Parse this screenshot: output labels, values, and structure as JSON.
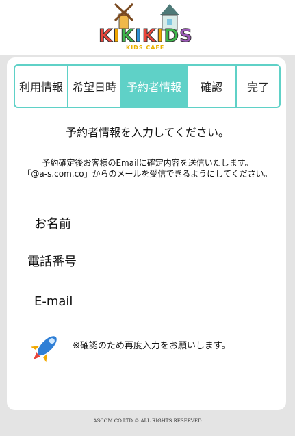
{
  "brand": {
    "logo_letters": [
      "K",
      "I",
      "K",
      "I",
      "K",
      "I",
      "D",
      "S"
    ],
    "logo_colors": [
      "#e8453c",
      "#f2a900",
      "#3db54a",
      "#2c8fd6",
      "#e8453c",
      "#f2a900",
      "#3db54a",
      "#9b59b6"
    ],
    "tagline": "KIDS CAFE"
  },
  "steps": [
    {
      "label": "利用情報",
      "active": false
    },
    {
      "label": "希望日時",
      "active": false
    },
    {
      "label": "予約者情報",
      "active": true
    },
    {
      "label": "確認",
      "active": false
    },
    {
      "label": "完了",
      "active": false
    }
  ],
  "accent_color": "#5fd1c7",
  "form": {
    "heading": "予約者情報を入力してください。",
    "notice_line1": "予約確定後お客様のEmailに確定内容を送信いたします。",
    "notice_line2": "「@a-s.com.co」からのメールを受信できるようにしてください。",
    "name_label": "お名前",
    "phone_label": "電話番号",
    "email_label": "E-mail",
    "reconfirm_note": "※確認のため再度入力をお願いします。"
  },
  "footer": {
    "copyright": "ASCOM CO.LTD © ALL RIGHTS RESERVED"
  }
}
